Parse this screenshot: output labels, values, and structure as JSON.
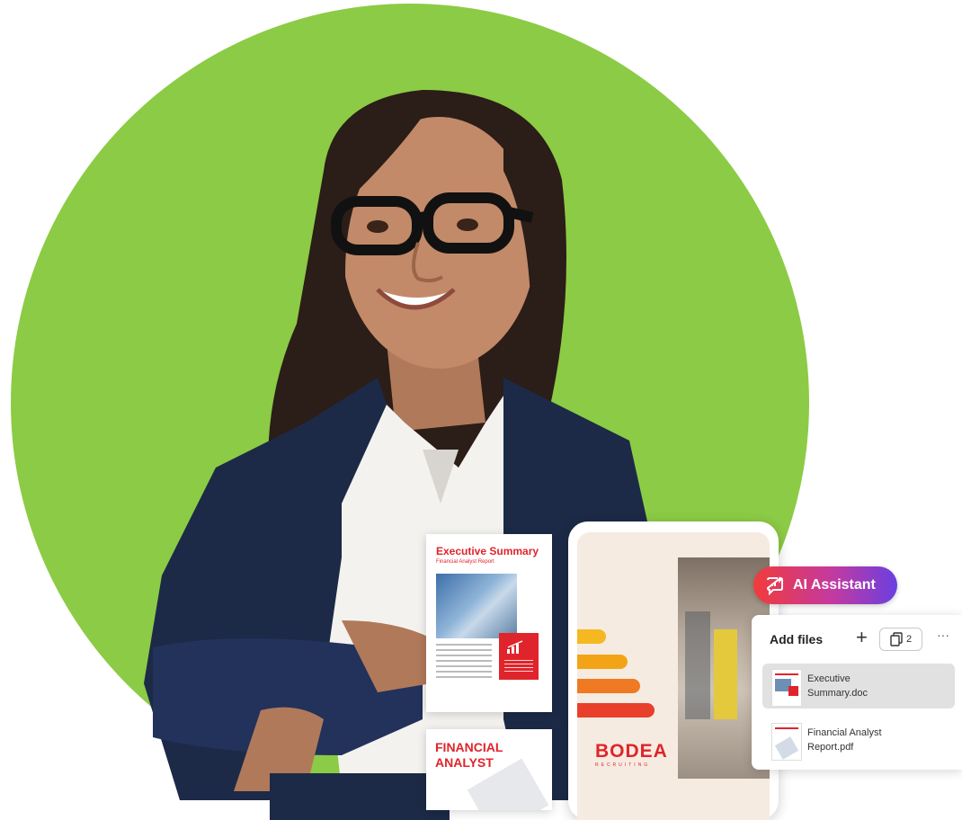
{
  "documents": {
    "executive_summary": {
      "title": "Executive Summary",
      "subtitle": "Financial Analyst Report"
    },
    "financial_analyst": {
      "title_line1": "FINANCIAL",
      "title_line2": "ANALYST"
    },
    "brand_card": {
      "brand": "BODEA",
      "tagline": "RECRUITING"
    }
  },
  "ai_assistant": {
    "label": "AI Assistant",
    "icon": "ai-chat-icon"
  },
  "add_files_panel": {
    "title": "Add files",
    "add_icon": "plus-icon",
    "file_count": "2",
    "more_icon": "more-dots-icon",
    "files": [
      {
        "name_line1": "Executive",
        "name_line2": "Summary.doc",
        "selected": true
      },
      {
        "name_line1": "Financial Analyst",
        "name_line2": "Report.pdf",
        "selected": false
      }
    ]
  },
  "colors": {
    "circle": "#8ccb45",
    "accent_red": "#e0242b",
    "pill_gradient_start": "#f23b3b",
    "pill_gradient_end": "#6a3fe0"
  }
}
